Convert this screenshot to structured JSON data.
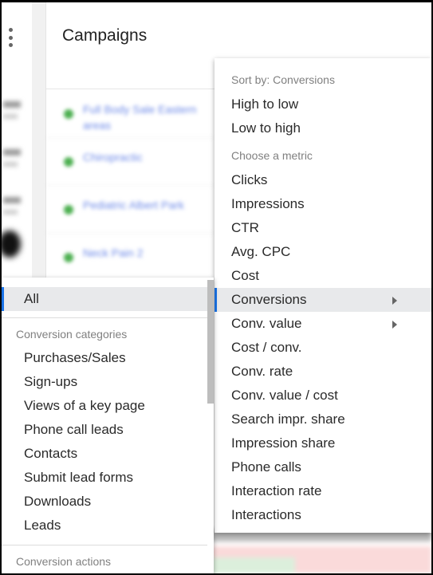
{
  "page": {
    "title": "Campaigns"
  },
  "background_rows": [
    {
      "name": "Full Body Sale Eastern areas",
      "status_color": "#4caf50"
    },
    {
      "name": "Chiropractic",
      "status_color": "#4caf50"
    },
    {
      "name": "Pediatric Albert Park",
      "status_color": "#4caf50"
    },
    {
      "name": "Neck Pain 2",
      "status_color": "#4caf50"
    }
  ],
  "sort_menu": {
    "sort_header": "Sort by: Conversions",
    "sort_options": [
      {
        "label": "High to low"
      },
      {
        "label": "Low to high"
      }
    ],
    "metric_header": "Choose a metric",
    "metrics": [
      {
        "label": "Clicks",
        "has_submenu": false,
        "active": false
      },
      {
        "label": "Impressions",
        "has_submenu": false,
        "active": false
      },
      {
        "label": "CTR",
        "has_submenu": false,
        "active": false
      },
      {
        "label": "Avg. CPC",
        "has_submenu": false,
        "active": false
      },
      {
        "label": "Cost",
        "has_submenu": false,
        "active": false
      },
      {
        "label": "Conversions",
        "has_submenu": true,
        "active": true
      },
      {
        "label": "Conv. value",
        "has_submenu": true,
        "active": false
      },
      {
        "label": "Cost / conv.",
        "has_submenu": false,
        "active": false
      },
      {
        "label": "Conv. rate",
        "has_submenu": false,
        "active": false
      },
      {
        "label": "Conv. value / cost",
        "has_submenu": false,
        "active": false
      },
      {
        "label": "Search impr. share",
        "has_submenu": false,
        "active": false
      },
      {
        "label": "Impression share",
        "has_submenu": false,
        "active": false
      },
      {
        "label": "Phone calls",
        "has_submenu": false,
        "active": false
      },
      {
        "label": "Interaction rate",
        "has_submenu": false,
        "active": false
      },
      {
        "label": "Interactions",
        "has_submenu": false,
        "active": false
      }
    ]
  },
  "conversions_submenu": {
    "all_label": "All",
    "categories_header": "Conversion categories",
    "categories": [
      {
        "label": "Purchases/Sales"
      },
      {
        "label": "Sign-ups"
      },
      {
        "label": "Views of a key page"
      },
      {
        "label": "Phone call leads"
      },
      {
        "label": "Contacts"
      },
      {
        "label": "Submit lead forms"
      },
      {
        "label": "Downloads"
      },
      {
        "label": "Leads"
      }
    ],
    "actions_header": "Conversion actions"
  },
  "colors": {
    "accent": "#1a73e8",
    "active_bg": "#e8e9eb",
    "status_green": "#4caf50"
  }
}
